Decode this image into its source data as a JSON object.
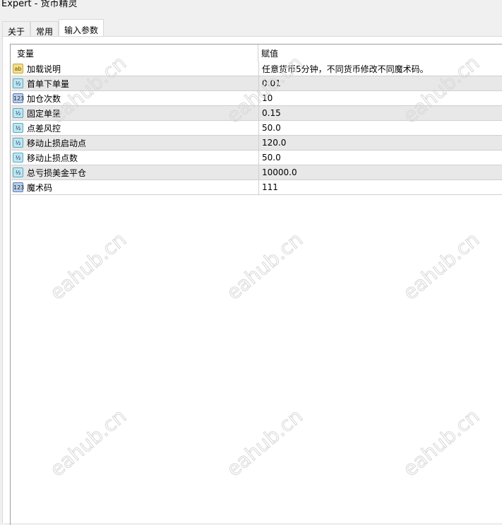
{
  "title": "Expert - 货币精灵",
  "tabs": [
    "关于",
    "常用",
    "输入参数"
  ],
  "table": {
    "headers": [
      "变量",
      "赋值"
    ],
    "rows": [
      {
        "icon": "string-icon",
        "glyph": "ab",
        "name": "加载说明",
        "value": "任意货币5分钟，不同货币修改不同魔术码。"
      },
      {
        "icon": "double-icon",
        "glyph": "½",
        "name": "首单下单量",
        "value": "0.01"
      },
      {
        "icon": "integer-icon",
        "glyph": "123",
        "name": "加仓次数",
        "value": "10"
      },
      {
        "icon": "double-icon",
        "glyph": "½",
        "name": "固定单量",
        "value": "0.15"
      },
      {
        "icon": "double-icon",
        "glyph": "½",
        "name": "点差风控",
        "value": "50.0"
      },
      {
        "icon": "double-icon",
        "glyph": "½",
        "name": "移动止损启动点",
        "value": "120.0"
      },
      {
        "icon": "double-icon",
        "glyph": "½",
        "name": "移动止损点数",
        "value": "50.0"
      },
      {
        "icon": "double-icon",
        "glyph": "½",
        "name": "总亏损美金平仓",
        "value": "10000.0"
      },
      {
        "icon": "integer-icon",
        "glyph": "123",
        "name": "魔术码",
        "value": "111"
      }
    ]
  },
  "watermark": "eahub.cn"
}
